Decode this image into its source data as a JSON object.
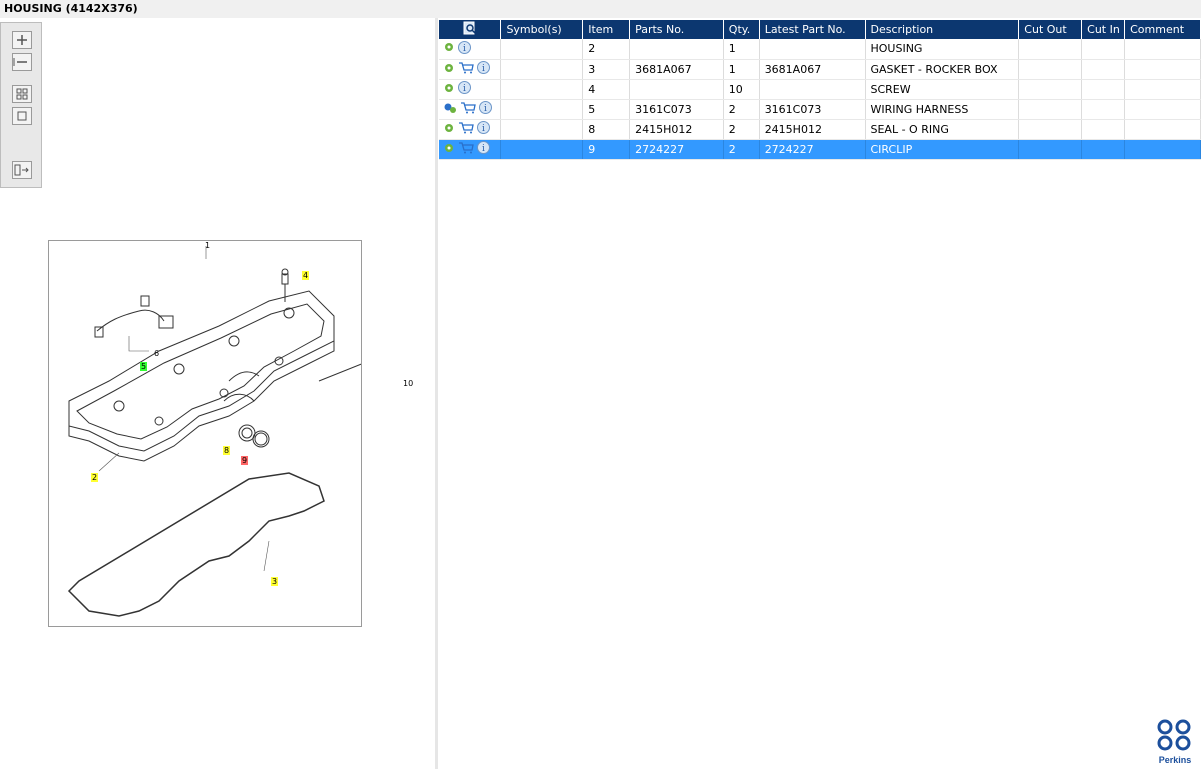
{
  "window": {
    "title": "HOUSING (4142X376)"
  },
  "toolbar": {
    "buttons": [
      {
        "name": "zoom-in-button",
        "icon": "plus-icon"
      },
      {
        "name": "zoom-out-button",
        "icon": "minus-icon"
      },
      {
        "name": "fit-all-button",
        "icon": "grid-icon"
      },
      {
        "name": "fit-window-button",
        "icon": "square-icon"
      },
      {
        "name": "panel-toggle-button",
        "icon": "list-arrow-icon"
      }
    ]
  },
  "drawing": {
    "callouts": [
      {
        "label": "1",
        "style": "n"
      },
      {
        "label": "4",
        "style": "y"
      },
      {
        "label": "6",
        "style": "n"
      },
      {
        "label": "5",
        "style": "g"
      },
      {
        "label": "10",
        "style": "n"
      },
      {
        "label": "8",
        "style": "y"
      },
      {
        "label": "9",
        "style": "r"
      },
      {
        "label": "2",
        "style": "y"
      },
      {
        "label": "3",
        "style": "y"
      }
    ]
  },
  "table": {
    "columns": [
      "",
      "Symbol(s)",
      "Item",
      "Parts No.",
      "Qty.",
      "Latest Part No.",
      "Description",
      "Cut Out",
      "Cut In",
      "Comment"
    ],
    "rows": [
      {
        "icons": [
          "gear-icon",
          "info-icon"
        ],
        "symbols": "",
        "item": "2",
        "part_no": "",
        "qty": "1",
        "latest_part_no": "",
        "description": "HOUSING",
        "cut_out": "",
        "cut_in": "",
        "comment": "",
        "selected": false
      },
      {
        "icons": [
          "gear-icon",
          "cart-icon",
          "info-icon"
        ],
        "symbols": "",
        "item": "3",
        "part_no": "3681A067",
        "qty": "1",
        "latest_part_no": "3681A067",
        "description": "GASKET - ROCKER BOX",
        "cut_out": "",
        "cut_in": "",
        "comment": "",
        "selected": false
      },
      {
        "icons": [
          "gear-icon",
          "info-icon"
        ],
        "symbols": "",
        "item": "4",
        "part_no": "",
        "qty": "10",
        "latest_part_no": "",
        "description": "SCREW",
        "cut_out": "",
        "cut_in": "",
        "comment": "",
        "selected": false
      },
      {
        "icons": [
          "gears-icon",
          "cart-icon",
          "info-icon"
        ],
        "symbols": "",
        "item": "5",
        "part_no": "3161C073",
        "qty": "2",
        "latest_part_no": "3161C073",
        "description": "WIRING HARNESS",
        "cut_out": "",
        "cut_in": "",
        "comment": "",
        "selected": false
      },
      {
        "icons": [
          "gear-icon",
          "cart-icon",
          "info-icon"
        ],
        "symbols": "",
        "item": "8",
        "part_no": "2415H012",
        "qty": "2",
        "latest_part_no": "2415H012",
        "description": "SEAL - O RING",
        "cut_out": "",
        "cut_in": "",
        "comment": "",
        "selected": false
      },
      {
        "icons": [
          "gear-icon",
          "cart-icon",
          "info-icon"
        ],
        "symbols": "",
        "item": "9",
        "part_no": "2724227",
        "qty": "2",
        "latest_part_no": "2724227",
        "description": "CIRCLIP",
        "cut_out": "",
        "cut_in": "",
        "comment": "",
        "selected": true
      }
    ]
  },
  "branding": {
    "logo_text": "Perkins"
  },
  "colors": {
    "header_bg": "#0c3770",
    "selected_row": "#3399ff",
    "callout_yellow": "#ffff33",
    "callout_green": "#33ff33",
    "callout_red": "#ff6666"
  }
}
